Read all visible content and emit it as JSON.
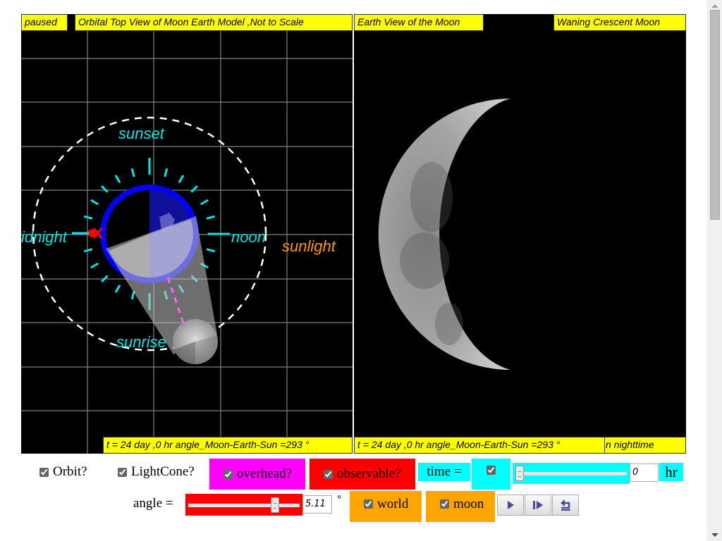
{
  "left_panel": {
    "status": "paused",
    "title": "Orbital Top View of Moon Earth Model ,Not to Scale",
    "footer": "t = 24 day ,0 hr angle_Moon-Earth-Sun =293 °",
    "labels": {
      "sunset": "sunset",
      "sunrise": "sunrise",
      "midnight": "idnight",
      "noon": "noon",
      "sunlight": "sunlight"
    },
    "colors": {
      "earth_ring": "#0000ff",
      "tick_marks": "#00e5e5",
      "orbit": "#ffffff",
      "observer_marker": "#ff0000",
      "sight_line": "#ff66ff",
      "sunlight_label": "#ff9900"
    }
  },
  "right_panel": {
    "title": "Earth View of the Moon",
    "phase": "Waning Crescent Moon",
    "footer": "t = 24 day ,0 hr angle_Moon-Earth-Sun =293 °",
    "status": "n nighttime"
  },
  "controls": {
    "orbit": {
      "label": "Orbit?",
      "checked": true
    },
    "lightcone": {
      "label": "LightCone?",
      "checked": true
    },
    "overhead": {
      "label": "overhead?",
      "checked": true
    },
    "observable": {
      "label": "observable?",
      "checked": true
    },
    "time": {
      "label": "time =",
      "checked": true,
      "value": "0",
      "unit": "hr",
      "slider_fraction": 0.0
    },
    "angle": {
      "label": "angle =",
      "value": "5.11",
      "unit": "°",
      "slider_fraction": 0.8
    },
    "world": {
      "label": "world",
      "checked": true
    },
    "moon": {
      "label": "moon",
      "checked": true
    },
    "buttons": [
      {
        "name": "play",
        "icon": "play-icon"
      },
      {
        "name": "step",
        "icon": "step-forward-icon"
      },
      {
        "name": "reset",
        "icon": "reset-icon"
      }
    ]
  },
  "theme": {
    "label_bg": "#ffff00",
    "overhead_bg": "#ff00ff",
    "observable_bg": "#ff0000",
    "time_bg": "#00ffff",
    "angle_bg": "#ff0000",
    "world_bg": "#ffa500",
    "moon_bg": "#ffa500"
  }
}
